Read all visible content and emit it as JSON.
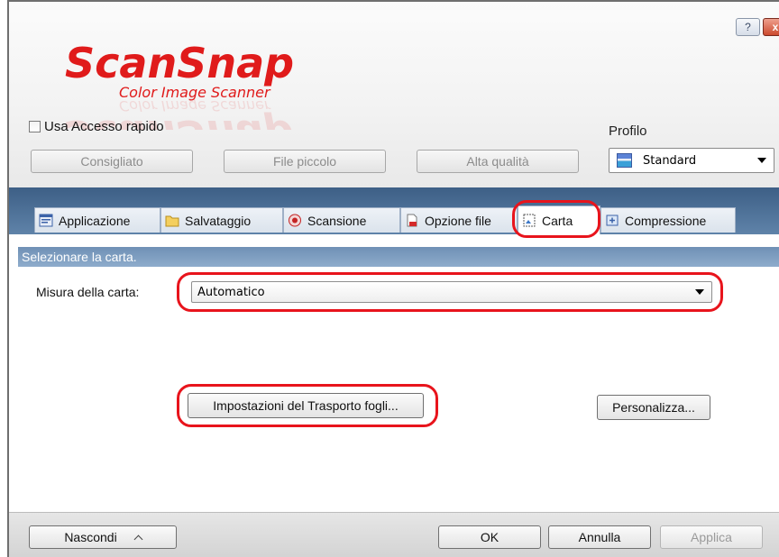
{
  "window": {
    "help_button": "?",
    "close_button": "x"
  },
  "logo": {
    "brand": "ScanSnap",
    "tagline": "Color Image Scanner"
  },
  "quick_access": {
    "label": "Usa Accesso rapido",
    "checked": false
  },
  "presets": [
    "Consigliato",
    "File piccolo",
    "Alta qualità"
  ],
  "profile": {
    "label": "Profilo",
    "selected": "Standard"
  },
  "tabs": [
    {
      "label": "Applicazione",
      "icon": "application-icon",
      "active": false
    },
    {
      "label": "Salvataggio",
      "icon": "folder-icon",
      "active": false
    },
    {
      "label": "Scansione",
      "icon": "scan-icon",
      "active": false
    },
    {
      "label": "Opzione file",
      "icon": "file-option-icon",
      "active": false
    },
    {
      "label": "Carta",
      "icon": "paper-icon",
      "active": true
    },
    {
      "label": "Compressione",
      "icon": "compression-icon",
      "active": false
    }
  ],
  "paper": {
    "section_title": "Selezionare la carta.",
    "size_label": "Misura della carta:",
    "size_value": "Automatico",
    "carrier_button": "Impostazioni del Trasporto fogli...",
    "customize_button": "Personalizza..."
  },
  "footer": {
    "hide_button": "Nascondi",
    "ok_button": "OK",
    "cancel_button": "Annulla",
    "apply_button": "Applica"
  },
  "colors": {
    "highlight": "#e8141c",
    "logo_red": "#e01b1b",
    "tab_band": "#4e6f96",
    "section_header": "#7d9cc0"
  }
}
